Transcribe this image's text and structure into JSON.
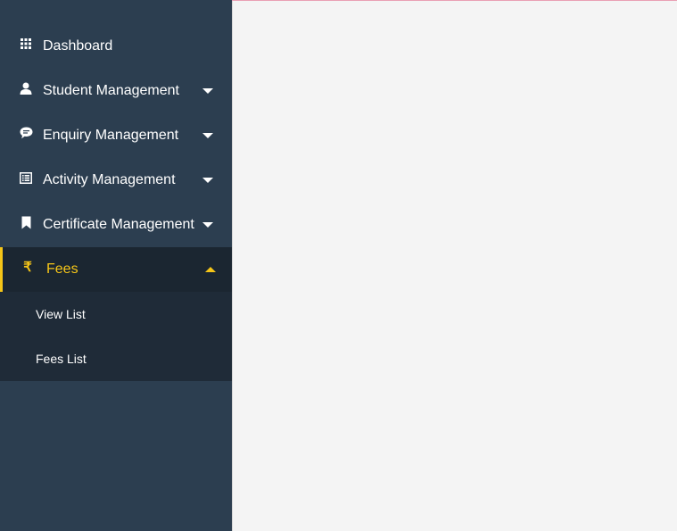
{
  "sidebar": {
    "items": [
      {
        "label": "Dashboard",
        "icon": "grid-icon"
      },
      {
        "label": "Student Management",
        "icon": "user-icon"
      },
      {
        "label": "Enquiry Management",
        "icon": "comment-icon"
      },
      {
        "label": "Activity Management",
        "icon": "list-icon"
      },
      {
        "label": "Certificate Management",
        "icon": "bookmark-icon"
      },
      {
        "label": "Fees",
        "icon": "rupee-icon",
        "symbol": "₹"
      }
    ],
    "fees_submenu": [
      {
        "label": "View List"
      },
      {
        "label": "Fees List"
      }
    ]
  },
  "colors": {
    "sidebar_bg": "#2c3e50",
    "active_bg": "#1b2631",
    "accent": "#f5c518",
    "content_bg": "#f4f4f4"
  }
}
